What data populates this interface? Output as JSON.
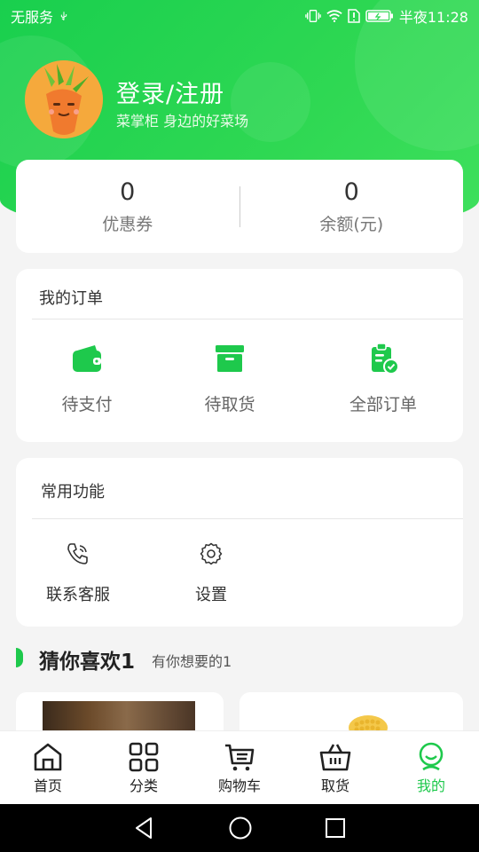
{
  "status_bar": {
    "carrier": "无服务",
    "time_label": "半夜11:28"
  },
  "profile": {
    "login_label": "登录/注册",
    "slogan": "菜掌柜 身边的好菜场"
  },
  "stats": [
    {
      "value": "0",
      "label": "优惠券"
    },
    {
      "value": "0",
      "label": "余额(元)"
    }
  ],
  "orders": {
    "title": "我的订单",
    "items": [
      {
        "label": "待支付",
        "icon": "wallet-icon"
      },
      {
        "label": "待取货",
        "icon": "box-icon"
      },
      {
        "label": "全部订单",
        "icon": "clipboard-check-icon"
      }
    ]
  },
  "functions": {
    "title": "常用功能",
    "items": [
      {
        "label": "联系客服",
        "icon": "phone-icon"
      },
      {
        "label": "设置",
        "icon": "gear-icon"
      }
    ]
  },
  "guess": {
    "title": "猜你喜欢1",
    "subtitle": "有你想要的1"
  },
  "tabbar": {
    "items": [
      {
        "label": "首页",
        "icon": "home-icon"
      },
      {
        "label": "分类",
        "icon": "grid-icon"
      },
      {
        "label": "购物车",
        "icon": "cart-icon"
      },
      {
        "label": "取货",
        "icon": "basket-icon"
      },
      {
        "label": "我的",
        "icon": "profile-icon",
        "active": true
      }
    ]
  },
  "colors": {
    "brand": "#1ec94c",
    "background": "#f4f4f4"
  }
}
